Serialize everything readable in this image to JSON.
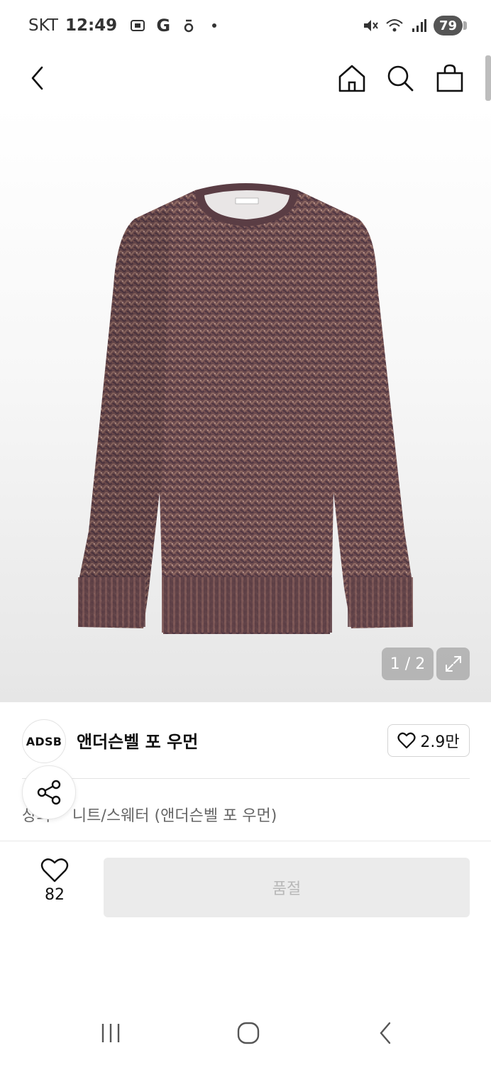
{
  "status_bar": {
    "carrier": "SKT",
    "time": "12:49",
    "icons": [
      "screenshot-icon",
      "g-app-icon",
      "notification-icon",
      "dot-icon"
    ],
    "right_icons": [
      "mute-icon",
      "wifi-icon",
      "signal-icon"
    ],
    "battery": "79"
  },
  "top_nav": {
    "back_icon": "chevron-left-icon",
    "home_icon": "home-icon",
    "search_icon": "search-icon",
    "cart_icon": "shopping-bag-icon"
  },
  "gallery": {
    "counter": "1 / 2",
    "expand_icon": "expand-icon"
  },
  "brand": {
    "logo_text": "ADSB",
    "name": "앤더슨벨 포 우먼",
    "likes": "2.9만"
  },
  "breadcrumb": {
    "items": [
      "상의",
      "니트/스웨터 (앤더슨벨 포 우먼)"
    ],
    "separator": ">"
  },
  "action_bar": {
    "wish_count": "82",
    "main_button": "품절"
  },
  "colors": {
    "soldout_bg": "#ebebeb",
    "soldout_text": "#b8b8b8",
    "sweater": "#6b4a4e"
  }
}
